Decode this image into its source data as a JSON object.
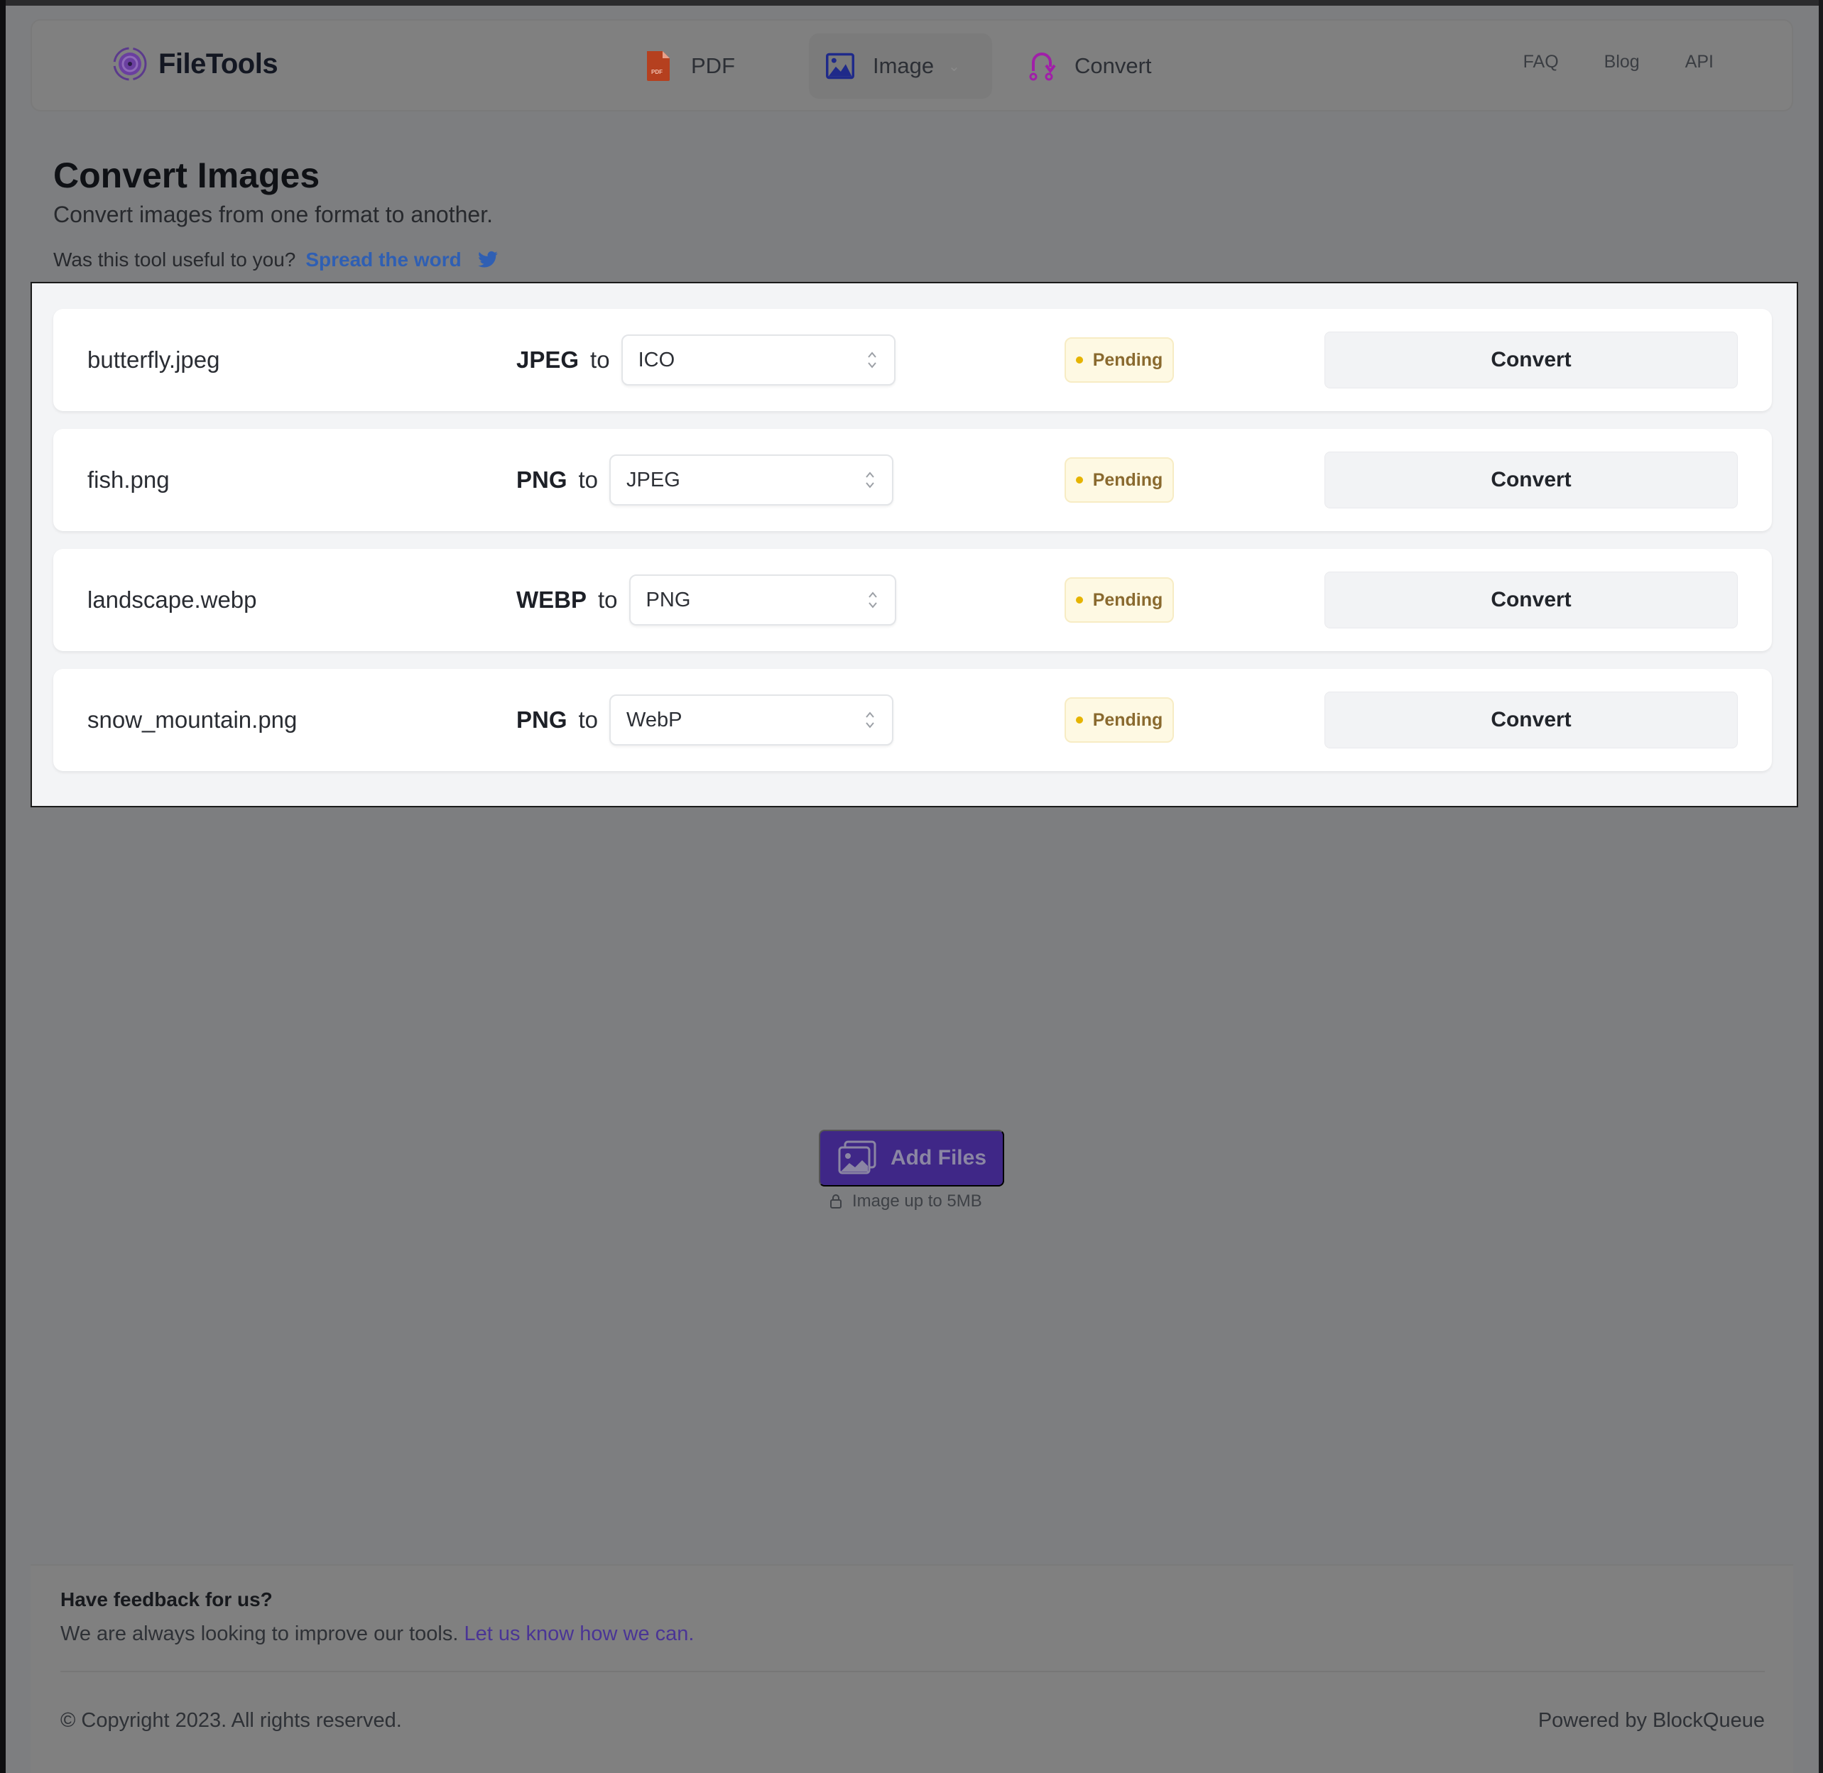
{
  "app": {
    "name": "FileTools"
  },
  "nav": {
    "items": [
      {
        "label": "PDF",
        "icon": "pdf-file-icon",
        "icon_color": "#c4401f"
      },
      {
        "label": "Image",
        "icon": "image-icon",
        "icon_color": "#1f2a8a",
        "active": true,
        "has_dropdown": true
      },
      {
        "label": "Convert",
        "icon": "convert-icon",
        "icon_color": "#b01fb0"
      }
    ],
    "links": [
      "FAQ",
      "Blog",
      "API"
    ]
  },
  "page": {
    "title": "Convert Images",
    "subtitle": "Convert images from one format to another.",
    "share_prompt": "Was this tool useful to you?",
    "share_link": "Spread the word",
    "share_icon": "twitter-icon"
  },
  "files": [
    {
      "name": "butterfly.jpeg",
      "from": "JPEG",
      "to_label": "to",
      "target": "ICO",
      "status": "Pending",
      "action": "Convert"
    },
    {
      "name": "fish.png",
      "from": "PNG",
      "to_label": "to",
      "target": "JPEG",
      "status": "Pending",
      "action": "Convert"
    },
    {
      "name": "landscape.webp",
      "from": "WEBP",
      "to_label": "to",
      "target": "PNG",
      "status": "Pending",
      "action": "Convert"
    },
    {
      "name": "snow_mountain.png",
      "from": "PNG",
      "to_label": "to",
      "target": "WebP",
      "status": "Pending",
      "action": "Convert"
    }
  ],
  "upload": {
    "button_label": "Add Files",
    "hint": "Image up to 5MB"
  },
  "footer": {
    "feedback_title": "Have feedback for us?",
    "feedback_text": "We are always looking to improve our tools.",
    "feedback_link": "Let us know how we can.",
    "copyright": "© Copyright 2023. All rights reserved.",
    "powered_by": "Powered by BlockQueue"
  },
  "colors": {
    "accent": "#3f2787",
    "link": "#2f5fb3",
    "pending_bg": "#fef9e3",
    "pending_dot": "#e6b400"
  }
}
